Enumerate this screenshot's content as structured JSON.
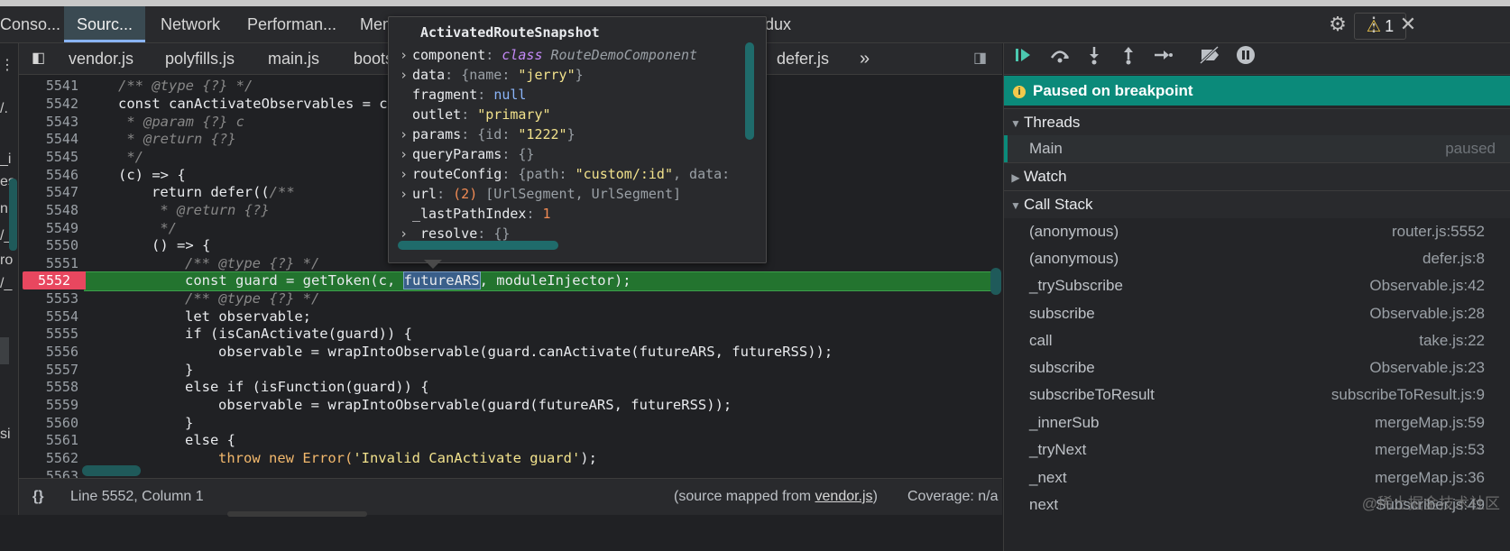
{
  "tabs": [
    "Conso...",
    "Sourc...",
    "Network",
    "Performan...",
    "Mem",
    "dux"
  ],
  "warnings": {
    "icon": "warning-icon",
    "count": "1"
  },
  "editor": {
    "files": [
      "vendor.js",
      "polyfills.js",
      "main.js",
      "boots",
      "defer.js"
    ],
    "lines": [
      {
        "n": "5541"
      },
      {
        "n": "5542"
      },
      {
        "n": "5543"
      },
      {
        "n": "5544"
      },
      {
        "n": "5545"
      },
      {
        "n": "5546"
      },
      {
        "n": "5547"
      },
      {
        "n": "5548"
      },
      {
        "n": "5549"
      },
      {
        "n": "5550"
      },
      {
        "n": "5551"
      },
      {
        "n": "5552"
      },
      {
        "n": "5553"
      },
      {
        "n": "5554"
      },
      {
        "n": "5555"
      },
      {
        "n": "5556"
      },
      {
        "n": "5557"
      },
      {
        "n": "5558"
      },
      {
        "n": "5559"
      },
      {
        "n": "5560"
      },
      {
        "n": "5561"
      },
      {
        "n": "5562"
      },
      {
        "n": "5563"
      }
    ],
    "code": {
      "l5541": "/** @type {?} */",
      "l5542a": "const canActivateObservables = ca",
      "l5543": " * @param {?} c",
      "l5544": " * @return {?}",
      "l5545": " */",
      "l5546": "(c) => {",
      "l5547a": "return defer((",
      "l5547b": "/**",
      "l5548": " * @return {?}",
      "l5549": " */",
      "l5550": "() => {",
      "l5551": "/** @type {?} */",
      "l5552a": "const guard = getToken(c, ",
      "l5552b": "futureARS",
      "l5552c": ", moduleInjector);",
      "l5553": "/** @type {?} */",
      "l5554": "let observable;",
      "l5555": "if (isCanActivate(guard)) {",
      "l5556": "observable = wrapIntoObservable(guard.canActivate(futureARS, futureRSS));",
      "l5557": "}",
      "l5558": "else if (isFunction(guard)) {",
      "l5559": "observable = wrapIntoObservable(guard(futureARS, futureRSS));",
      "l5560": "}",
      "l5561": "else {",
      "l5562a": "throw new Error(",
      "l5562b": "'Invalid CanActivate guard'",
      "l5562c": ");"
    }
  },
  "tooltip": {
    "title": "ActivatedRouteSnapshot",
    "rows": {
      "component_key": "component",
      "component_class": "class",
      "component_val": "RouteDemoComponent",
      "data_key": "data",
      "data_pre": "{name: ",
      "data_val": "\"jerry\"",
      "data_post": "}",
      "fragment_key": "fragment",
      "fragment_val": "null",
      "outlet_key": "outlet",
      "outlet_val": "\"primary\"",
      "params_key": "params",
      "params_pre": "{id: ",
      "params_val": "\"1222\"",
      "params_post": "}",
      "query_key": "queryParams",
      "query_val": "{}",
      "route_key": "routeConfig",
      "route_pre": "{path: ",
      "route_val": "\"custom/:id\"",
      "route_post": ", data:",
      "url_key": "url",
      "url_count": "(2)",
      "url_val": "[UrlSegment, UrlSegment]",
      "lpi_key": "_lastPathIndex",
      "lpi_val": "1",
      "resolve_key": "_resolve",
      "resolve_val": "{}"
    }
  },
  "status": {
    "braces": "{}",
    "position": "Line 5552, Column 1",
    "source_prefix": "(source mapped from ",
    "source_link": "vendor.js",
    "source_suffix": ")",
    "coverage": "Coverage: n/a"
  },
  "debugger": {
    "paused": "Paused on breakpoint",
    "threads_label": "Threads",
    "main_thread": "Main",
    "main_status": "paused",
    "watch_label": "Watch",
    "callstack_label": "Call Stack",
    "frames": [
      {
        "fn": "(anonymous)",
        "loc": "router.js:5552"
      },
      {
        "fn": "(anonymous)",
        "loc": "defer.js:8"
      },
      {
        "fn": "_trySubscribe",
        "loc": "Observable.js:42"
      },
      {
        "fn": "subscribe",
        "loc": "Observable.js:28"
      },
      {
        "fn": "call",
        "loc": "take.js:22"
      },
      {
        "fn": "subscribe",
        "loc": "Observable.js:23"
      },
      {
        "fn": "subscribeToResult",
        "loc": "subscribeToResult.js:9"
      },
      {
        "fn": "_innerSub",
        "loc": "mergeMap.js:59"
      },
      {
        "fn": "_tryNext",
        "loc": "mergeMap.js:53"
      },
      {
        "fn": "_next",
        "loc": "mergeMap.js:36"
      },
      {
        "fn": "next",
        "loc": "Subscriber.js:49"
      }
    ]
  },
  "watermark": "@稀土掘金技术社区",
  "colors": {
    "accent": "#0b8a7a",
    "breakpoint": "#e8475f",
    "highlight": "#23742f"
  }
}
